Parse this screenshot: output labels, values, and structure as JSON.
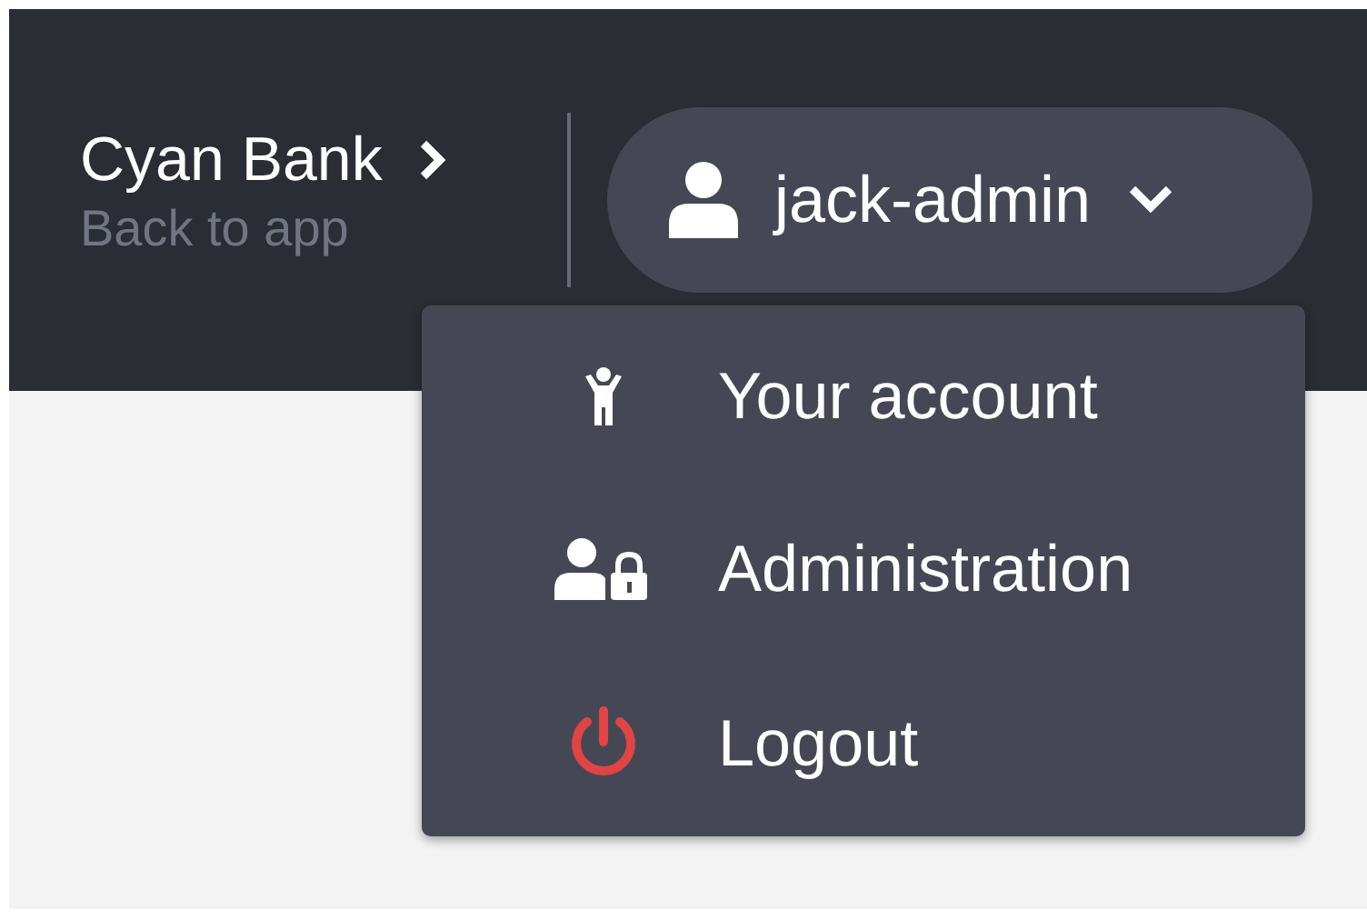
{
  "brand": {
    "title": "Cyan Bank",
    "subtitle": "Back to app"
  },
  "user_menu": {
    "username": "jack-admin",
    "expanded": true
  },
  "menu_items": [
    {
      "label": "Your account",
      "kind": "account"
    },
    {
      "label": "Administration",
      "kind": "admin"
    },
    {
      "label": "Logout",
      "kind": "logout"
    }
  ]
}
